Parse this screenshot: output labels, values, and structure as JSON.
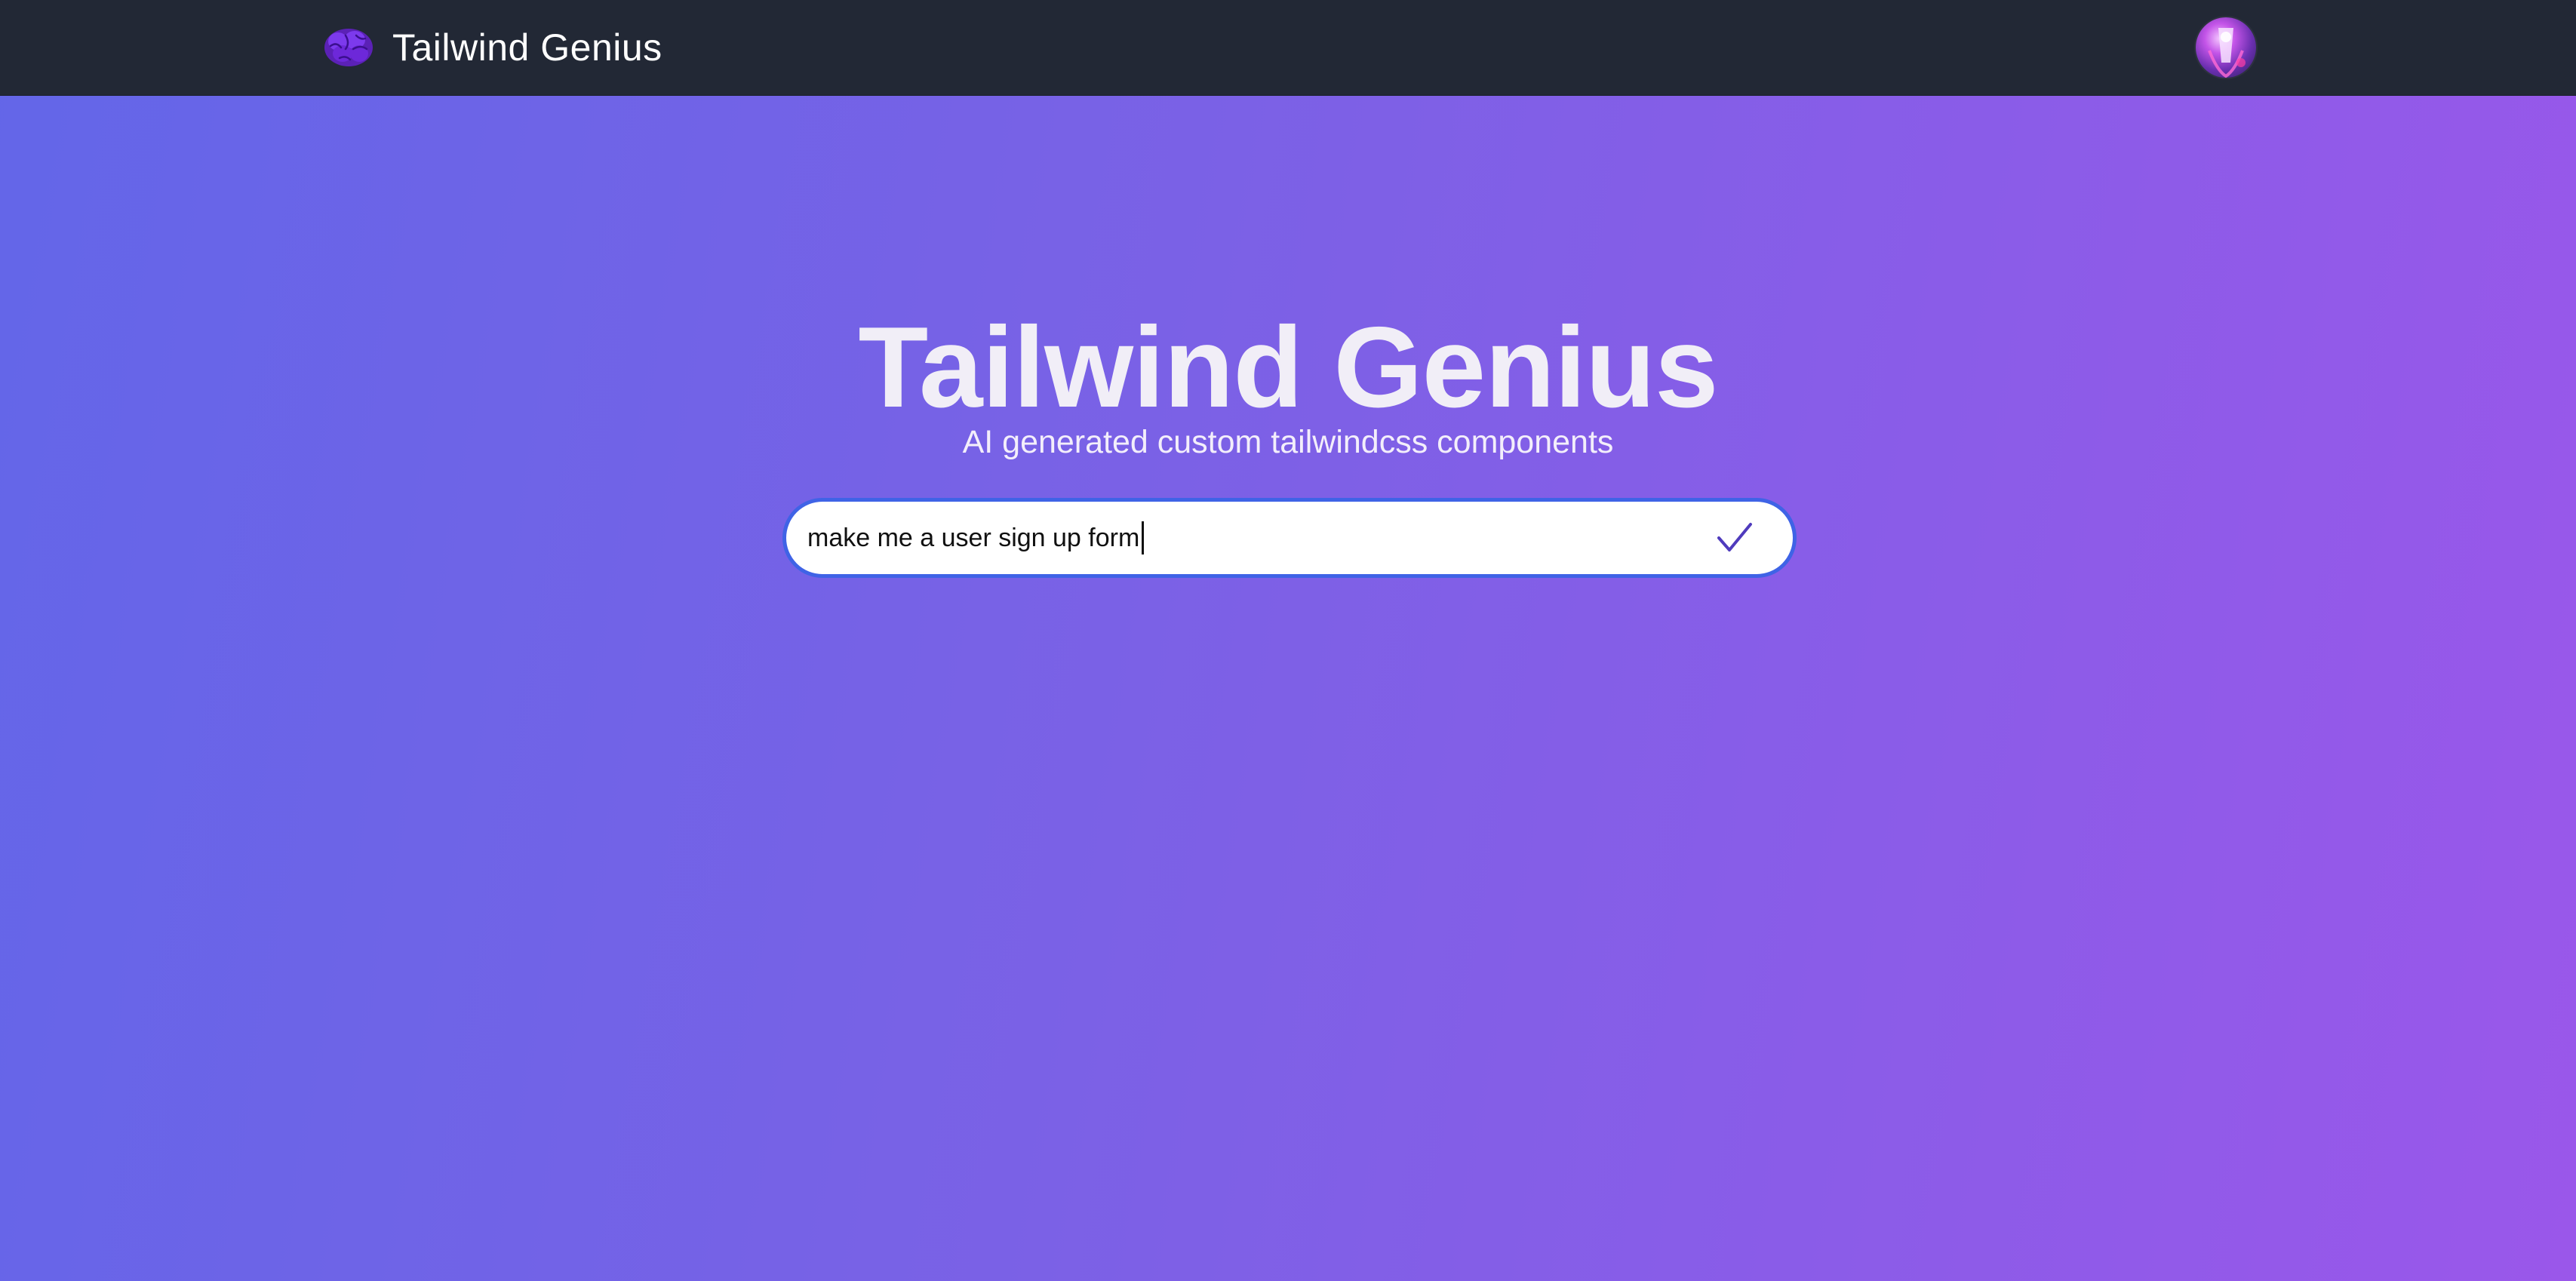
{
  "navbar": {
    "brand_name": "Tailwind Genius",
    "brand_icon": "brain-icon",
    "avatar_icon": "user-avatar"
  },
  "hero": {
    "title": "Tailwind Genius",
    "subtitle": "AI generated custom tailwindcss components"
  },
  "search": {
    "value": "make me a user sign up form",
    "submit_icon": "checkmark-icon"
  },
  "colors": {
    "navbar_bg": "#222835",
    "gradient_start": "#6366e8",
    "gradient_end": "#9a57ea",
    "input_border": "#3f63e6",
    "brand_icon": "#6d28d9",
    "check_icon": "#4f3bbd"
  }
}
